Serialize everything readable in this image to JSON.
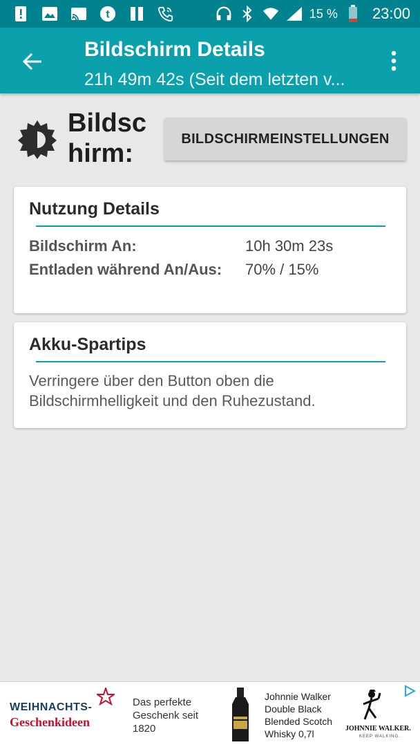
{
  "status_bar": {
    "battery_percent": "15 %",
    "time": "23:00",
    "left_icons": [
      "alert-icon",
      "image-icon",
      "cast-icon",
      "tumblr-icon",
      "pause-icon",
      "wifi-calling-icon"
    ],
    "right_icons": [
      "headphones-icon",
      "bluetooth-icon",
      "wifi-icon",
      "signal-icon",
      "battery-icon"
    ]
  },
  "app_bar": {
    "title": "Bildschirm Details",
    "subtitle": "21h 49m 42s (Seit dem letzten v...",
    "accent": "#0aa1ac",
    "statusbar_color": "#00838f"
  },
  "header": {
    "title": "Bildschirm:",
    "settings_button": "BILDSCHIRMEINSTELLUNGEN"
  },
  "usage": {
    "title": "Nutzung Details",
    "rows": [
      {
        "label": "Bildschirm An:",
        "value": "10h 30m 23s"
      },
      {
        "label": "Entladen während An/Aus:",
        "value": "70% / 15%"
      }
    ]
  },
  "tips": {
    "title": "Akku-Spartips",
    "text": "Verringere über den Button oben die Bildschirmhelligkeit und den Ruhezustand."
  },
  "ad": {
    "brand_line1": "WEIHNACHTS-",
    "brand_line2": "Geschenkideen",
    "tagline": "Das perfekte Geschenk seit 1820",
    "product": "Johnnie Walker Double Black Blended Scotch Whisky 0,7l",
    "logo_text": "JOHNNIE WALKER.",
    "logo_slogan": "KEEP WALKING."
  }
}
